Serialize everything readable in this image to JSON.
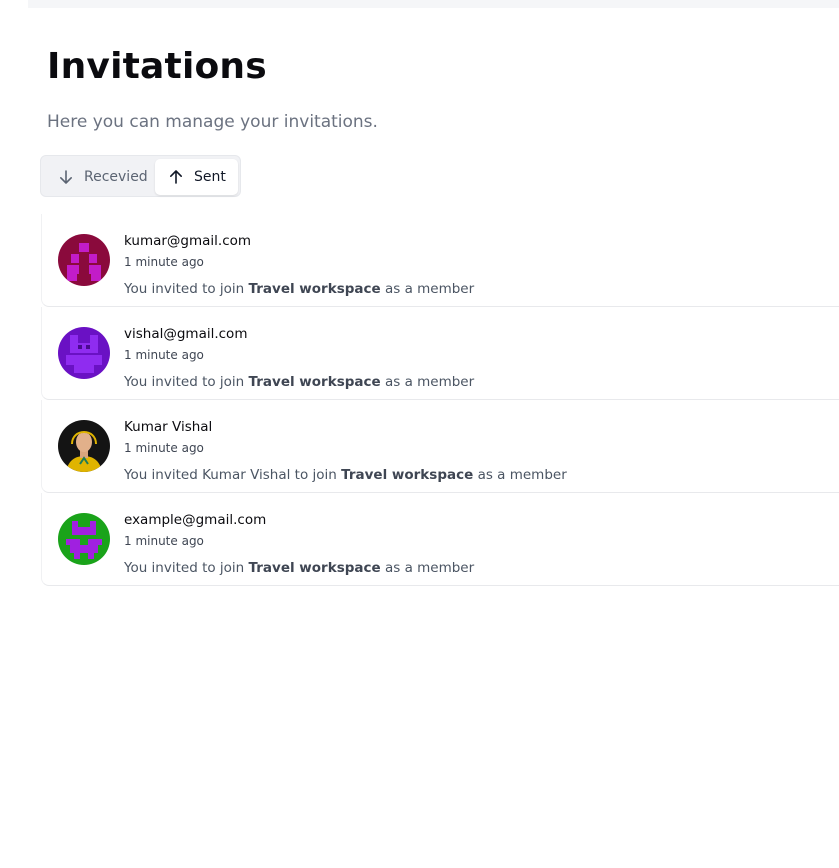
{
  "header": {
    "title": "Invitations",
    "subtitle": "Here you can manage your invitations."
  },
  "tabs": [
    {
      "label": "Recevied",
      "icon": "arrow-down-icon",
      "active": false
    },
    {
      "label": "Sent",
      "icon": "arrow-up-icon",
      "active": true
    }
  ],
  "colors": {
    "avatar_1": "#8a0a3c",
    "avatar_1_pattern": "#c21cc8",
    "avatar_2": "#6a11c4",
    "avatar_2_pattern": "#8f2cf0",
    "avatar_3": "#1a1a1a",
    "avatar_3_accent": "#e0b400",
    "avatar_4": "#1aa31a",
    "avatar_4_pattern": "#a020e0"
  },
  "invitations": [
    {
      "who": "kumar@gmail.com",
      "time": "1 minute ago",
      "prefix": "You invited to join",
      "workspace": "Travel workspace",
      "suffix": "as a member",
      "avatar": "identicon-avatar"
    },
    {
      "who": "vishal@gmail.com",
      "time": "1 minute ago",
      "prefix": "You invited to join",
      "workspace": "Travel workspace",
      "suffix": "as a member",
      "avatar": "identicon-avatar"
    },
    {
      "who": "Kumar Vishal",
      "time": "1 minute ago",
      "prefix": "You invited Kumar Vishal to join",
      "workspace": "Travel workspace",
      "suffix": "as a member",
      "avatar": "user-photo-avatar"
    },
    {
      "who": "example@gmail.com",
      "time": "1 minute ago",
      "prefix": "You invited to join",
      "workspace": "Travel workspace",
      "suffix": "as a member",
      "avatar": "identicon-avatar"
    }
  ]
}
